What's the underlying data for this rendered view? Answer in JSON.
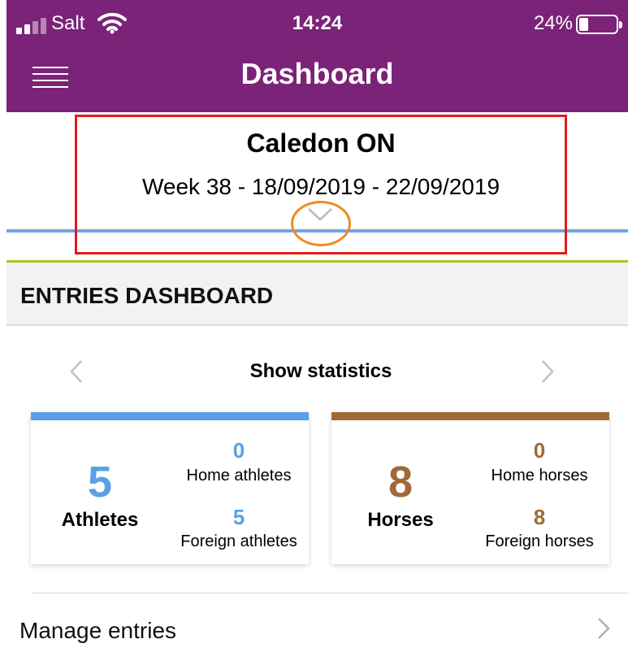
{
  "status_bar": {
    "carrier": "Salt",
    "time": "14:24",
    "battery_percent": "24%",
    "battery_level": 0.24,
    "signal_icon": "signal-bars-icon",
    "wifi_icon": "wifi-icon"
  },
  "header": {
    "title": "Dashboard",
    "menu_icon": "hamburger-menu-icon",
    "background": "#7a2379"
  },
  "event": {
    "name": "Caledon ON",
    "week": "Week 38 - 18/09/2019 - 22/09/2019",
    "expand_icon": "chevron-down-icon"
  },
  "section": {
    "title": "ENTRIES DASHBOARD"
  },
  "stats_nav": {
    "label": "Show statistics",
    "prev_icon": "chevron-left-icon",
    "next_icon": "chevron-right-icon"
  },
  "cards": {
    "athletes": {
      "total": "5",
      "total_label": "Athletes",
      "home_value": "0",
      "home_label": "Home athletes",
      "foreign_value": "5",
      "foreign_label": "Foreign athletes",
      "accent": "#5aa0e6"
    },
    "horses": {
      "total": "8",
      "total_label": "Horses",
      "home_value": "0",
      "home_label": "Home horses",
      "foreign_value": "8",
      "foreign_label": "Foreign horses",
      "accent": "#a06a37"
    }
  },
  "manage": {
    "label": "Manage entries",
    "chevron_icon": "chevron-right-icon"
  },
  "colors": {
    "highlight_box": "#e11b1b",
    "highlight_circle": "#f08a24",
    "blue_divider": "#6ea6e6",
    "green_divider": "#a8c520"
  }
}
